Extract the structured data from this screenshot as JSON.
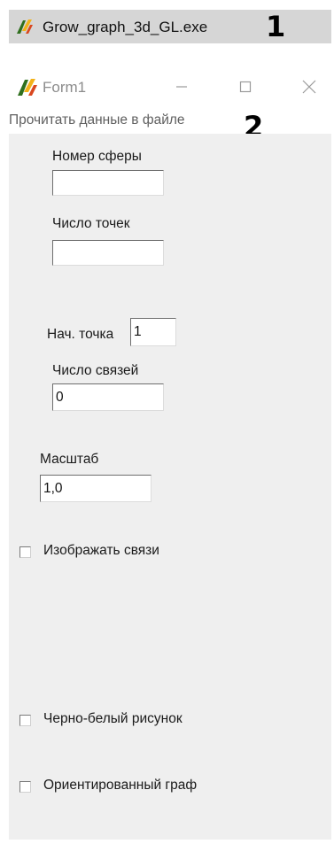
{
  "taskbar": {
    "exe_name": "Grow_graph_3d_GL.exe",
    "marker": "1",
    "icon": "app-icon"
  },
  "window": {
    "title": "Form1",
    "icon": "app-icon",
    "controls": {
      "minimize": "minimize-icon",
      "maximize": "maximize-icon",
      "close": "close-icon"
    }
  },
  "menu": {
    "items": [
      {
        "label": "Прочитать данные в файле"
      }
    ],
    "marker": "2"
  },
  "form": {
    "sphere_number": {
      "label": "Номер сферы",
      "value": ""
    },
    "point_count": {
      "label": "Число точек",
      "value": ""
    },
    "start_point": {
      "label": "Нач. точка",
      "value": "1"
    },
    "link_count": {
      "label": "Число связей",
      "value": "0"
    },
    "scale": {
      "label": "Масштаб",
      "value": "1,0"
    },
    "checkboxes": [
      {
        "label": "Изображать связи",
        "checked": false
      },
      {
        "label": "Черно-белый рисунок",
        "checked": false
      },
      {
        "label": "Ориентированный граф",
        "checked": false
      }
    ]
  },
  "colors": {
    "exe_strip": "#d6d6d6",
    "form_background": "#efefef",
    "title_text": "#8c8c8c",
    "menu_text": "#5f5f5f",
    "marker": "#000000"
  }
}
